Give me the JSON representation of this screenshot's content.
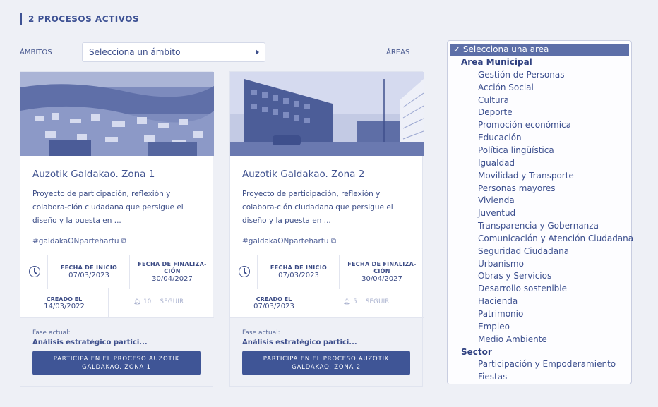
{
  "section": {
    "title": "2 PROCESOS ACTIVOS"
  },
  "filters": {
    "ambitos_label": "ÁMBITOS",
    "ambitos_value": "Selecciona un ámbito",
    "areas_label": "ÁREAS"
  },
  "cards": [
    {
      "title": "Auzotik Galdakao. Zona 1",
      "description": "Proyecto de participación, reflexión y colabora-ción ciudadana que persigue el diseño y la puesta en ...",
      "hashtag": "#galdakaONpartehartu",
      "start_label": "FECHA DE INICIO",
      "start_date": "07/03/2023",
      "end_label": "FECHA DE FINALIZA-CIÓN",
      "end_date": "30/04/2027",
      "created_label": "CREADO EL",
      "created_date": "14/03/2022",
      "followers": "10",
      "follow_label": "SEGUIR",
      "phase_label": "Fase actual:",
      "phase_value": "Análisis estratégico partici...",
      "cta": "PARTICIPA EN EL PROCESO AUZOTIK GALDAKAO. ZONA 1"
    },
    {
      "title": "Auzotik Galdakao. Zona 2",
      "description": "Proyecto de participación, reflexión y colabora-ción ciudadana que persigue el diseño y la puesta en ...",
      "hashtag": "#galdakaONpartehartu",
      "start_label": "FECHA DE INICIO",
      "start_date": "07/03/2023",
      "end_label": "FECHA DE FINALIZA-CIÓN",
      "end_date": "30/04/2027",
      "created_label": "CREADO EL",
      "created_date": "07/03/2023",
      "followers": "5",
      "follow_label": "SEGUIR",
      "phase_label": "Fase actual:",
      "phase_value": "Análisis estratégico partici...",
      "cta": "PARTICIPA EN EL PROCESO AUZOTIK GALDAKAO. ZONA 2"
    }
  ],
  "areas_dropdown": {
    "selected": "✓ Selecciona una area",
    "group1": "Area Municipal",
    "items1": [
      "Gestión de Personas",
      "Acción Social",
      "Cultura",
      "Deporte",
      "Promoción económica",
      "Educación",
      "Política lingüística",
      "Igualdad",
      "Movilidad y Transporte",
      "Personas mayores",
      "Vivienda",
      "Juventud",
      "Transparencia y Gobernanza",
      "Comunicación y Atención Ciudadana",
      "Seguridad Ciudadana",
      "Urbanismo",
      "Obras y Servicios",
      "Desarrollo sostenible",
      "Hacienda",
      "Patrimonio",
      "Empleo",
      "Medio Ambiente"
    ],
    "group2": "Sector",
    "items2": [
      "Participación y Empoderamiento",
      "Fiestas"
    ]
  },
  "colors": {
    "accent": "#3f5596",
    "text": "#3e4f8c",
    "background": "#eef0f6"
  }
}
